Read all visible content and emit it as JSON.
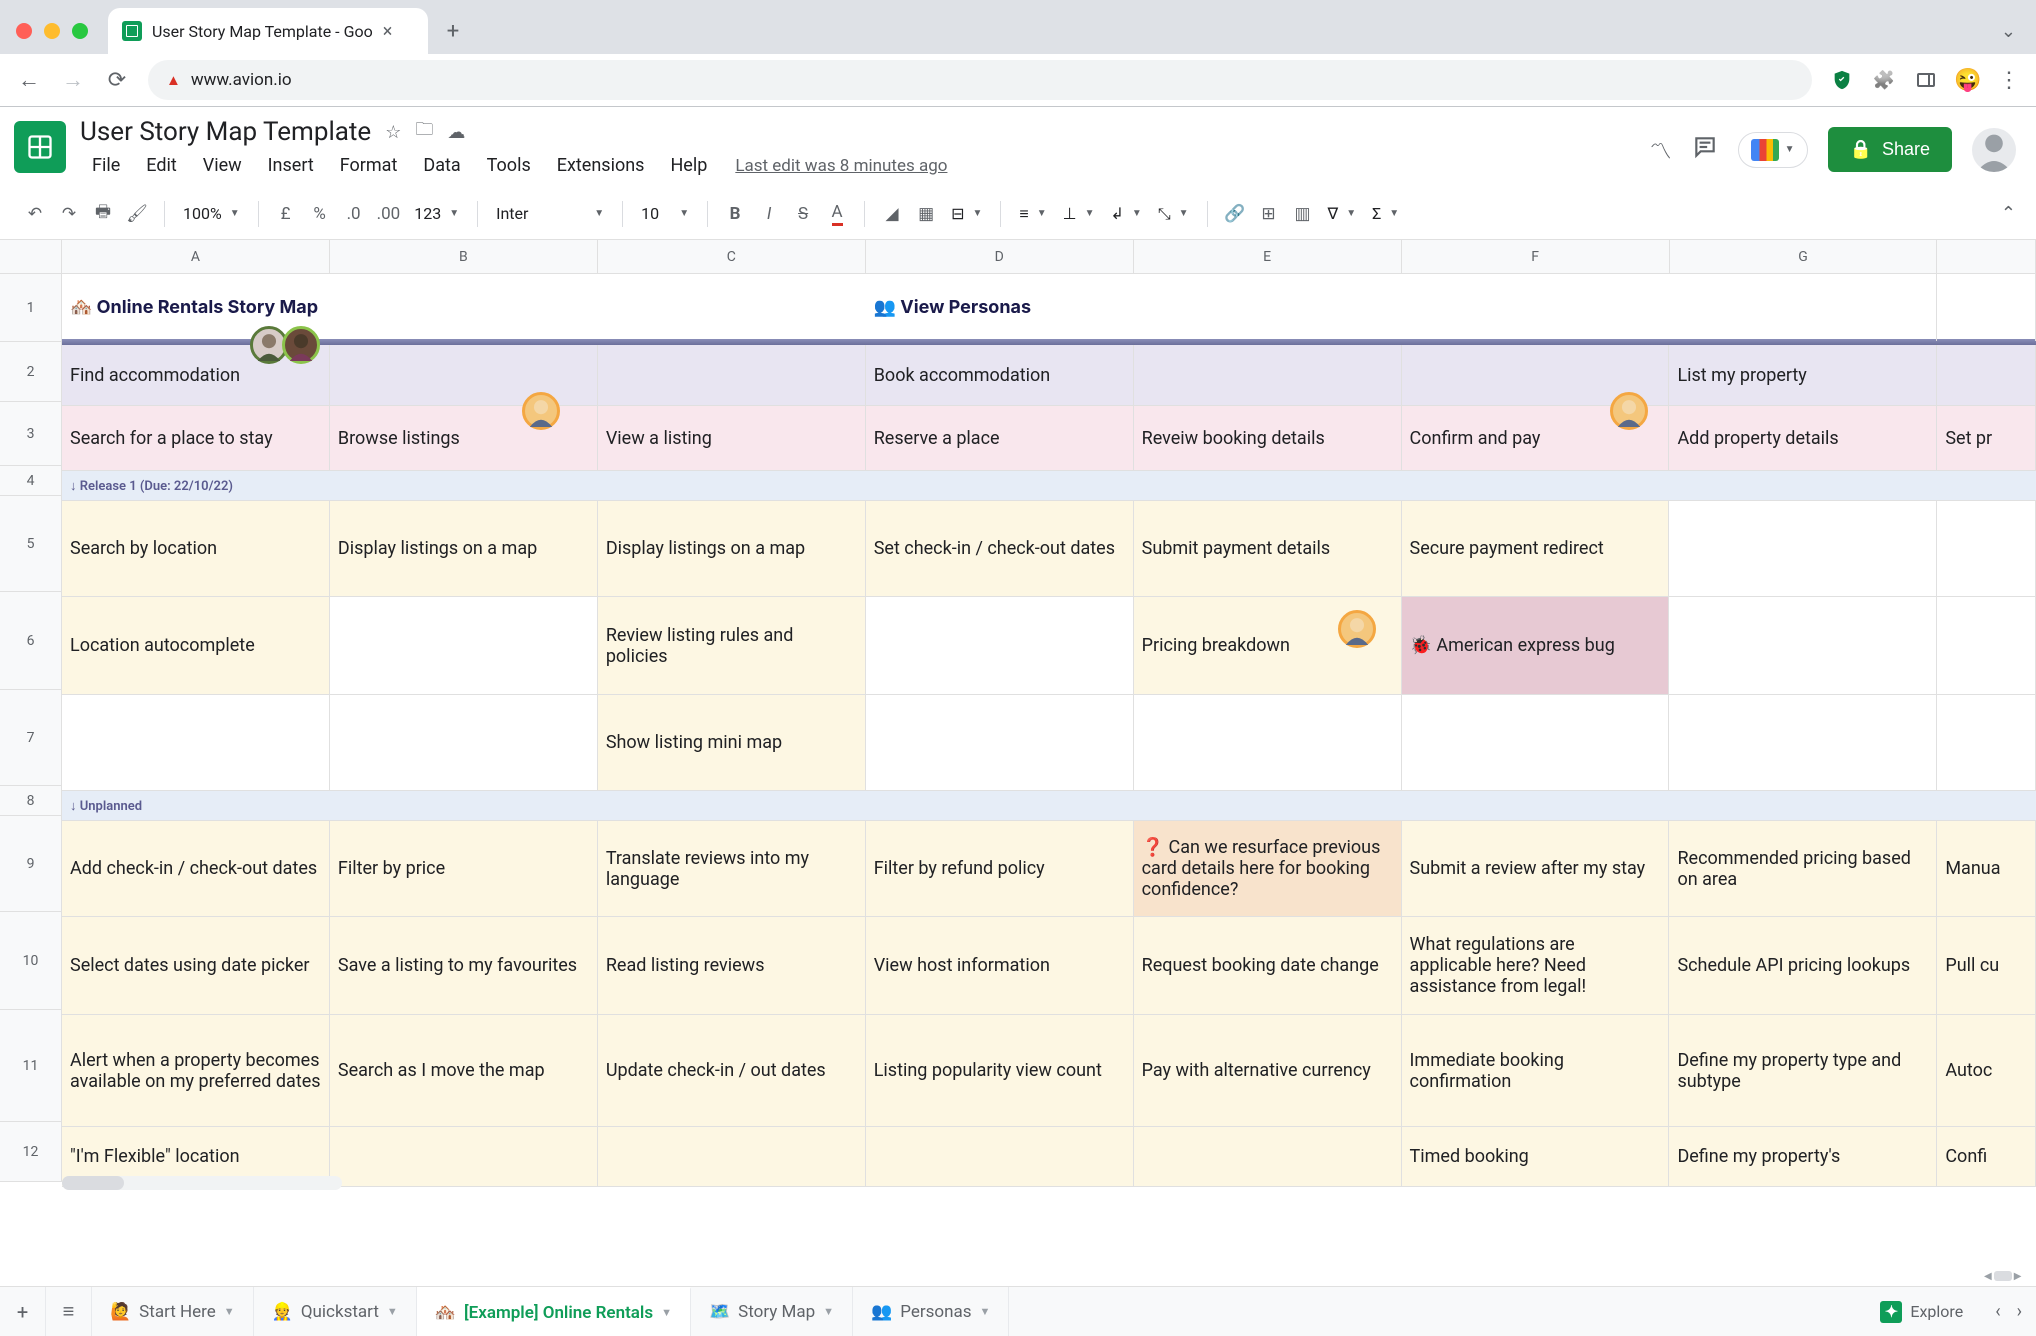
{
  "browser": {
    "tab_title": "User Story Map Template - Goo",
    "url": "www.avion.io"
  },
  "doc": {
    "title": "User Story Map Template",
    "last_edit": "Last edit was 8 minutes ago",
    "share_label": "Share"
  },
  "menus": [
    "File",
    "Edit",
    "View",
    "Insert",
    "Format",
    "Data",
    "Tools",
    "Extensions",
    "Help"
  ],
  "toolbar": {
    "zoom": "100%",
    "font": "Inter",
    "font_size": "10"
  },
  "columns": [
    "A",
    "B",
    "C",
    "D",
    "E",
    "F",
    "G"
  ],
  "rows": [
    "1",
    "2",
    "3",
    "4",
    "5",
    "6",
    "7",
    "8",
    "9",
    "10",
    "11",
    "12"
  ],
  "sheet": {
    "r1": {
      "a": "🏘️  Online Rentals Story Map",
      "d": "👥  View Personas"
    },
    "r2": {
      "a": "Find accommodation",
      "d": "Book accommodation",
      "g": "List my property"
    },
    "r3": {
      "a": "Search for a place to stay",
      "b": "Browse listings",
      "c": "View a listing",
      "d": "Reserve a place",
      "e": "Reveiw booking details",
      "f": "Confirm and pay",
      "g": "Add property details",
      "h": "Set pr"
    },
    "r4": {
      "label": "↓ Release 1 (Due: 22/10/22)"
    },
    "r5": {
      "a": "Search by location",
      "b": "Display listings on a map",
      "c": "Display listings on a map",
      "d": "Set check-in / check-out dates",
      "e": "Submit payment details",
      "f": "Secure payment redirect"
    },
    "r6": {
      "a": "Location autocomplete",
      "c": "Review listing rules and policies",
      "e": "Pricing breakdown",
      "f": "🐞  American express bug"
    },
    "r7": {
      "c": "Show listing mini map"
    },
    "r8": {
      "label": "↓ Unplanned"
    },
    "r9": {
      "a": "Add check-in / check-out dates",
      "b": "Filter by price",
      "c": "Translate reviews into my language",
      "d": "Filter by refund policy",
      "e": "❓  Can we resurface previous card details here for booking confidence?",
      "f": "Submit a review after my stay",
      "g": "Recommended pricing based on area",
      "h": "Manua"
    },
    "r10": {
      "a": "Select dates using date picker",
      "b": "Save a listing to my favourites",
      "c": "Read listing reviews",
      "d": "View host information",
      "e": "Request booking date change",
      "f": "What regulations are applicable here? Need assistance from legal!",
      "g": "Schedule API pricing lookups",
      "h": "Pull cu"
    },
    "r11": {
      "a": "Alert when a property becomes available on my preferred dates",
      "b": "Search as I move the map",
      "c": "Update check-in / out dates",
      "d": "Listing popularity view count",
      "e": "Pay with alternative currency",
      "f": "Immediate booking confirmation",
      "g": "Define my property type and subtype",
      "h": "Autoc"
    },
    "r12": {
      "a": "\"I'm Flexible\" location",
      "f": "Timed booking",
      "g": "Define my property's",
      "h": "Confi"
    }
  },
  "sheet_tabs": [
    {
      "icon": "🙋",
      "label": "Start Here"
    },
    {
      "icon": "👷",
      "label": "Quickstart"
    },
    {
      "icon": "🏘️",
      "label": "[Example] Online Rentals",
      "active": true
    },
    {
      "icon": "🗺️",
      "label": "Story Map"
    },
    {
      "icon": "👥",
      "label": "Personas"
    }
  ],
  "explore_label": "Explore"
}
